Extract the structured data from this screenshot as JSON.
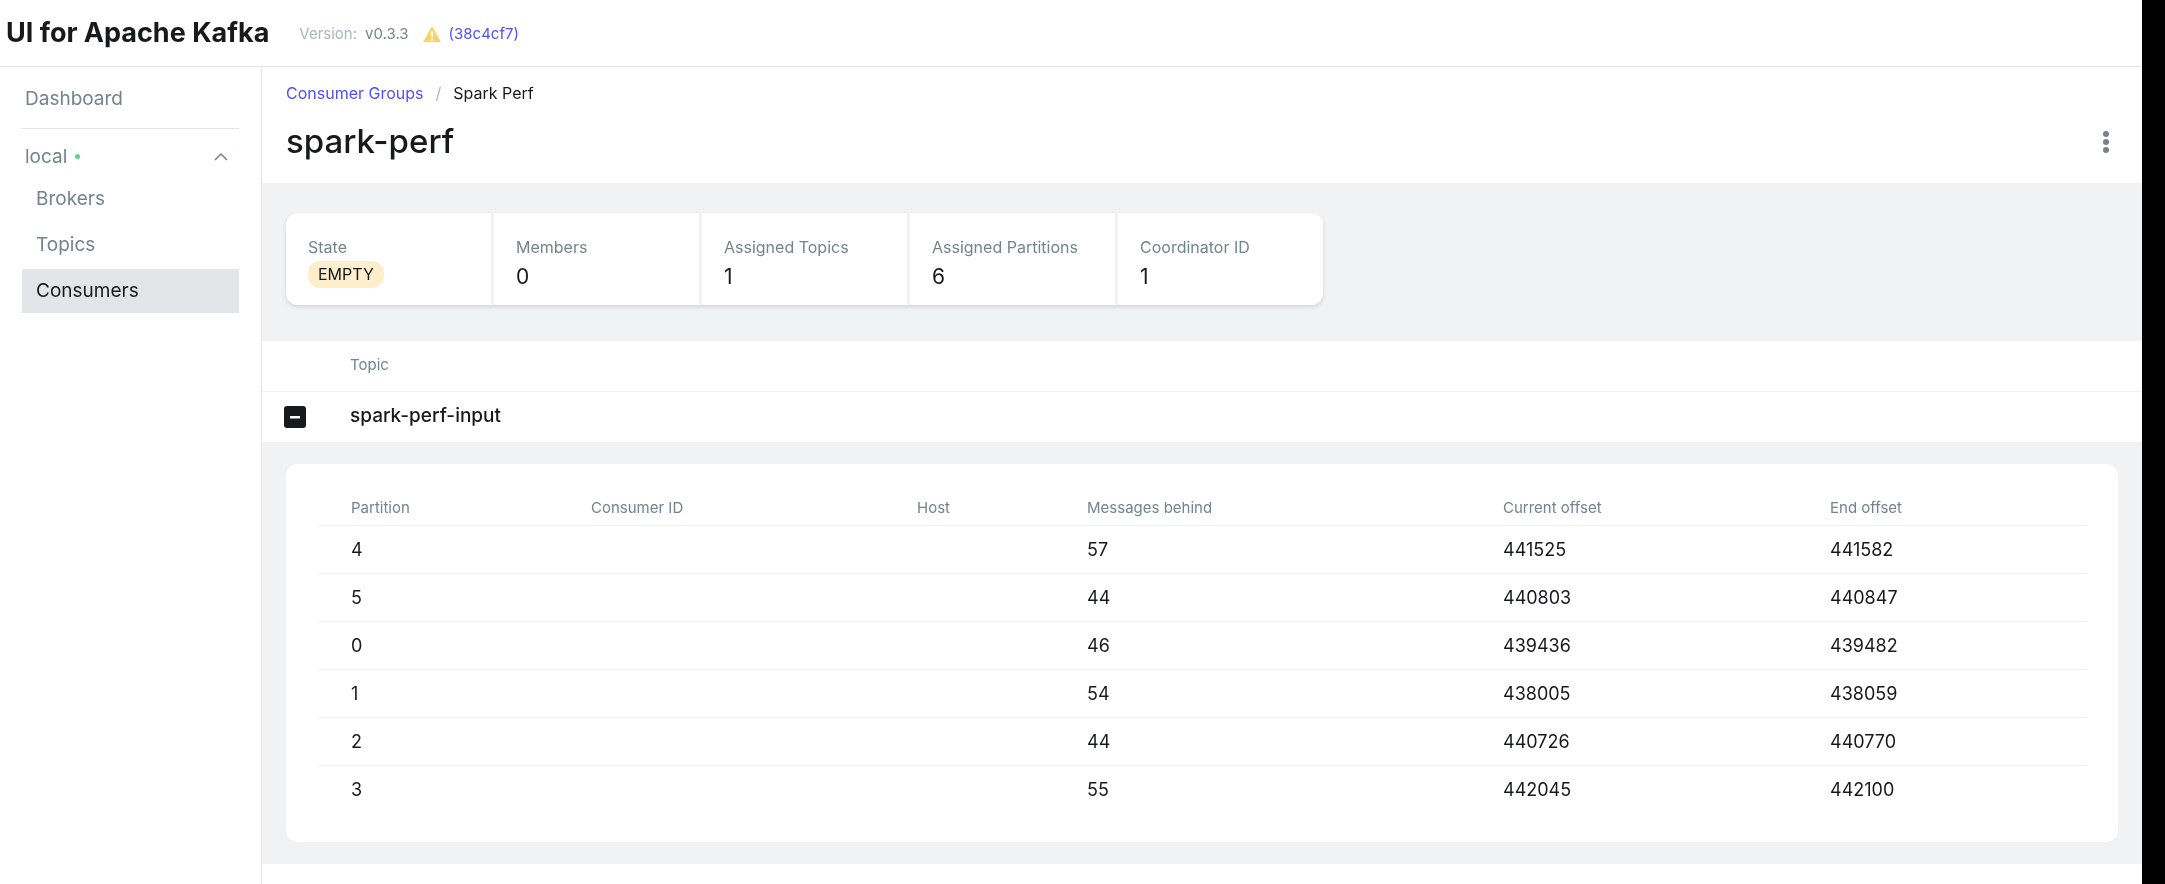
{
  "header": {
    "title": "UI for Apache Kafka",
    "version_label": "Version:",
    "version": "v0.3.3",
    "commit": "(38c4cf7)"
  },
  "sidebar": {
    "items": [
      {
        "label": "Dashboard",
        "kind": "top",
        "selected": false
      },
      {
        "label": "local",
        "kind": "cluster",
        "online": true,
        "expanded": true,
        "children": [
          {
            "label": "Brokers",
            "selected": false
          },
          {
            "label": "Topics",
            "selected": false
          },
          {
            "label": "Consumers",
            "selected": true
          }
        ]
      }
    ]
  },
  "breadcrumb_separator": "/",
  "breadcrumbs": [
    {
      "label": "Consumer Groups",
      "kind": "link"
    },
    {
      "label": "Spark Perf",
      "kind": "current"
    }
  ],
  "page_title": "spark-perf",
  "metrics": [
    {
      "label": "State",
      "value": "EMPTY",
      "kind": "badge"
    },
    {
      "label": "Members",
      "value": "0",
      "kind": "text"
    },
    {
      "label": "Assigned Topics",
      "value": "1",
      "kind": "text"
    },
    {
      "label": "Assigned Partitions",
      "value": "6",
      "kind": "text"
    },
    {
      "label": "Coordinator ID",
      "value": "1",
      "kind": "text"
    }
  ],
  "topics_table": {
    "column": "Topic",
    "rows": [
      {
        "name": "spark-perf-input",
        "expanded": true
      }
    ]
  },
  "partitions_table": {
    "columns": [
      "Partition",
      "Consumer ID",
      "Host",
      "Messages behind",
      "Current offset",
      "End offset"
    ],
    "rows": [
      [
        "4",
        "",
        "",
        "57",
        "441525",
        "441582"
      ],
      [
        "5",
        "",
        "",
        "44",
        "440803",
        "440847"
      ],
      [
        "0",
        "",
        "",
        "46",
        "439436",
        "439482"
      ],
      [
        "1",
        "",
        "",
        "54",
        "438005",
        "438059"
      ],
      [
        "2",
        "",
        "",
        "44",
        "440726",
        "440770"
      ],
      [
        "3",
        "",
        "",
        "55",
        "442045",
        "442100"
      ]
    ]
  }
}
